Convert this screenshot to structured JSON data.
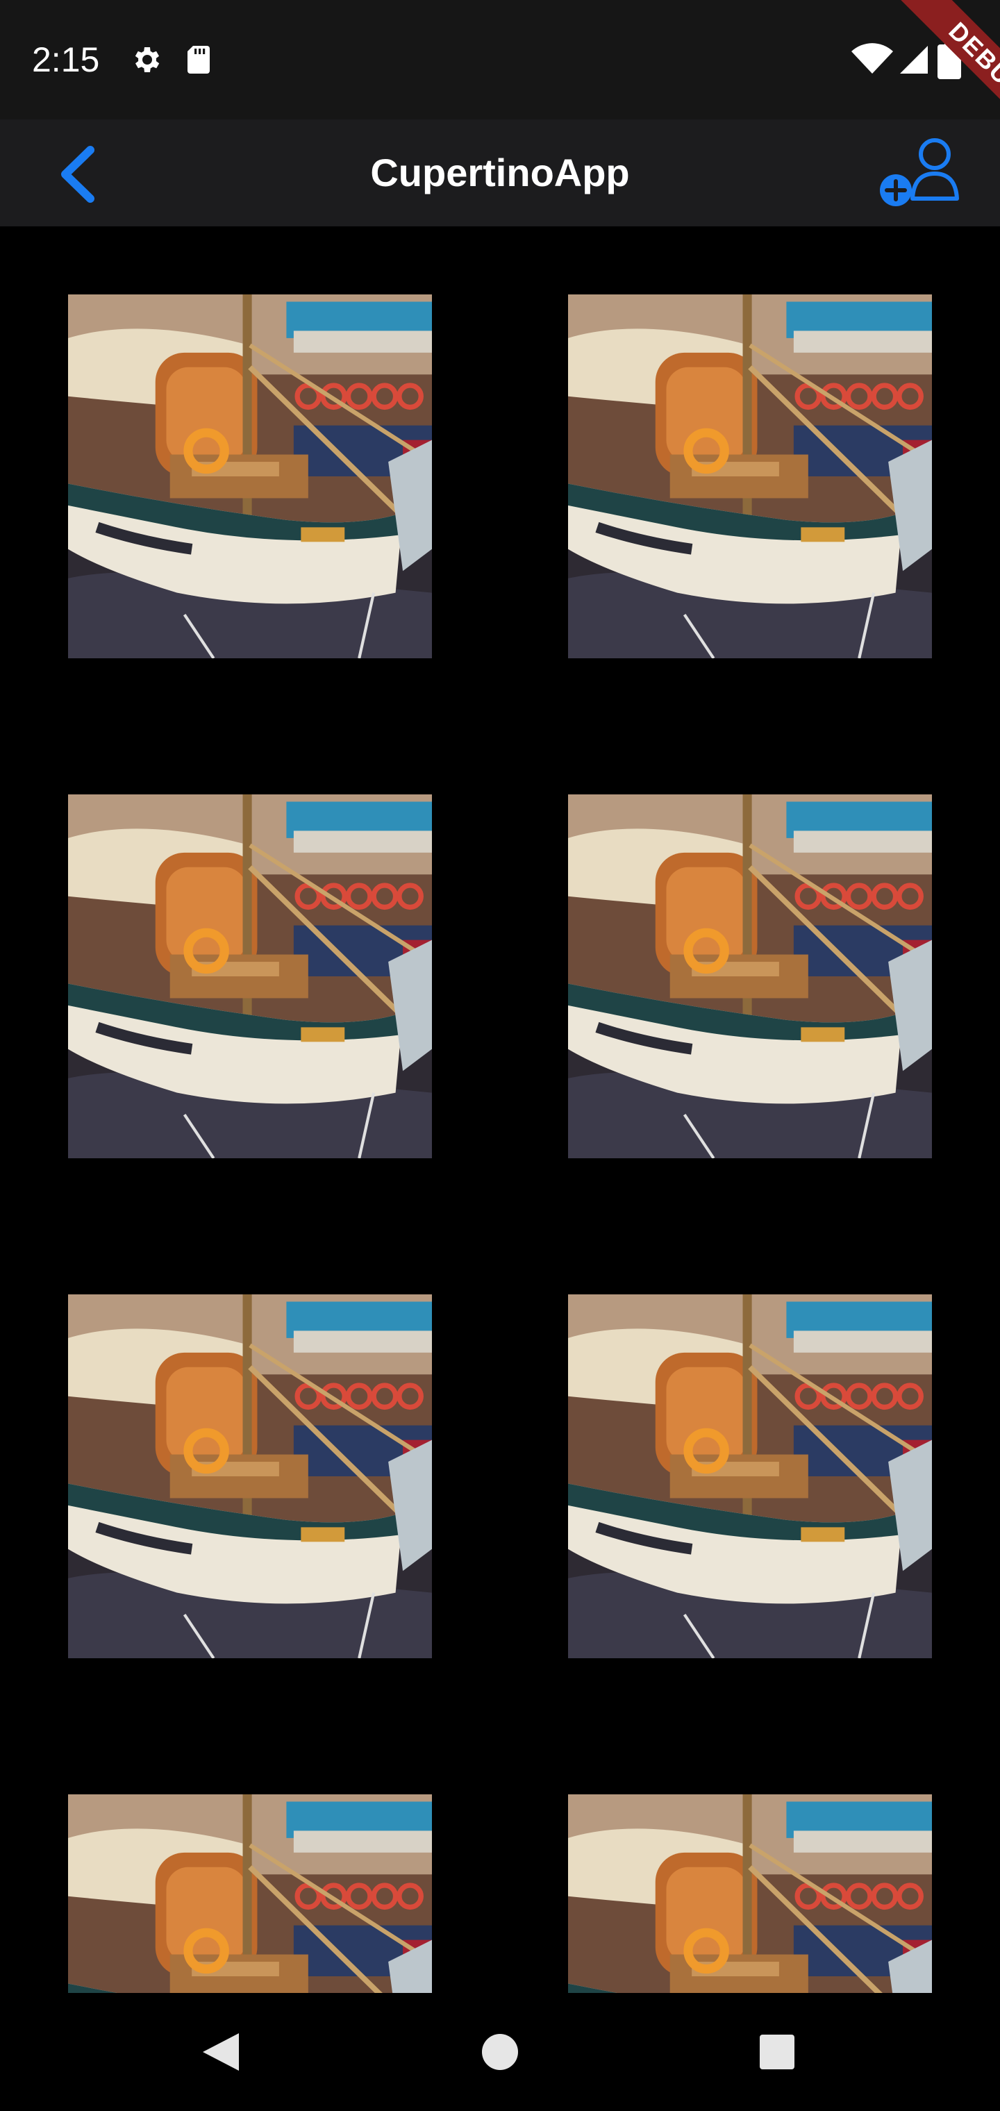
{
  "status_bar": {
    "time": "2:15",
    "left_icons": [
      "gear-icon",
      "sd-card-icon"
    ],
    "right_icons": [
      "wifi-icon",
      "cell-signal-icon",
      "battery-icon"
    ]
  },
  "nav_bar": {
    "title": "CupertinoApp",
    "back_icon": "chevron-left-icon",
    "action_icon": "person-add-icon",
    "accent_color": "#1a7cf2"
  },
  "debug_banner": {
    "label": "DEBUG"
  },
  "grid": {
    "columns": 2,
    "tiles": [
      {
        "image": "sailboat-photo"
      },
      {
        "image": "sailboat-photo"
      },
      {
        "image": "sailboat-photo"
      },
      {
        "image": "sailboat-photo"
      },
      {
        "image": "sailboat-photo"
      },
      {
        "image": "sailboat-photo"
      },
      {
        "image": "sailboat-photo"
      },
      {
        "image": "sailboat-photo"
      }
    ]
  },
  "system_nav": {
    "buttons": [
      "back-triangle-icon",
      "home-circle-icon",
      "recents-square-icon"
    ]
  }
}
